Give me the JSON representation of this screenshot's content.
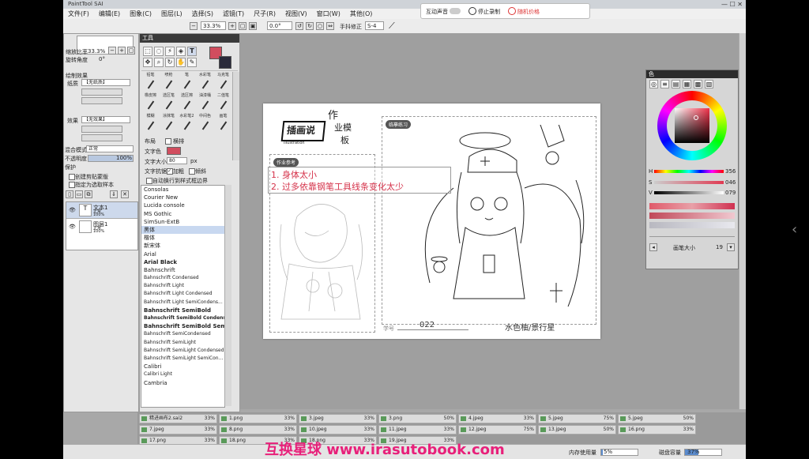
{
  "window": {
    "title": "PaintTool SAI"
  },
  "menu": [
    "文件(F)",
    "编辑(E)",
    "图象(C)",
    "图层(L)",
    "选择(S)",
    "滤镜(T)",
    "尺子(R)",
    "视图(V)",
    "窗口(W)",
    "其他(O)"
  ],
  "overlay": {
    "live_toggle_label": "互动声音",
    "stop_label": "停止录制",
    "restart_label": "随机价格"
  },
  "toolbar": {
    "zoom": "33.3%",
    "rotate": "0.0°",
    "stabilizer_label": "手抖修正",
    "stabilizer_value": "S-4"
  },
  "navigator": {
    "zoom_label": "缩放比率",
    "zoom_value": "33.3%",
    "angle_label": "旋转角度",
    "angle_value": "0°"
  },
  "layer_panel": {
    "effect_label": "绘制效果",
    "texture_label": "纸质",
    "texture_value": "【无纸质】",
    "effect2_label": "效果",
    "effect2_value": "【无效果】",
    "blend_label": "混合模式",
    "blend_value": "正常",
    "opacity_label": "不透明度",
    "opacity_value": "100%",
    "lock_label": "保护",
    "clip_group_label": "创建剪贴蒙版",
    "preset_label": "指定为选取样本",
    "layers": [
      {
        "name": "文本1",
        "mode": "正常",
        "opacity": "100%"
      },
      {
        "name": "图层1",
        "mode": "正常",
        "opacity": "100%"
      }
    ]
  },
  "tool_panel": {
    "title": "工具",
    "brushes": [
      "铅笔",
      "喷枪",
      "笔",
      "水彩笔",
      "马克笔",
      "橡皮擦",
      "选区笔",
      "选区擦",
      "油漆桶",
      "二值笔",
      "模糊",
      "涂抹笔",
      "水彩笔2",
      "中间色",
      "画笔"
    ],
    "layout_label": "布局",
    "layout_value": "横排",
    "color_label": "文字色",
    "size_label": "文字大小",
    "size_value": "80",
    "size_unit": "px",
    "antialias_label": "文字抗锯",
    "bold_label": "加粗",
    "italic_label": "倾斜",
    "wrap_label": "自动换行到样式框边界",
    "fonts": [
      "Consolas",
      "Courier New",
      "Lucida console",
      "MS Gothic",
      "SimSun-ExtB",
      "黑体",
      "楷体",
      "新宋体",
      "Arial",
      "Arial Black",
      "Bahnschrift",
      "Bahnschrift Condensed",
      "Bahnschrift Light",
      "Bahnschrift Light Condensed",
      "Bahnschrift Light SemiCondens...",
      "Bahnschrift SemiBold",
      "Bahnschrift SemiBold Condensed",
      "Bahnschrift SemiBold SemiCon...",
      "Bahnschrift SemiCondensed",
      "Bahnschrift SemiLight",
      "Bahnschrift SemiLight Condensed",
      "Bahnschrift SemiLight SemiCon...",
      "Calibri",
      "Calibri Light",
      "Cambria"
    ],
    "selected_font": "黑体"
  },
  "canvas": {
    "logo_main": "插画说",
    "logo_sub": "illustration",
    "logo_hw1": "作",
    "logo_hw2": "业模",
    "logo_hw3": "板",
    "left_tag": "作业参考",
    "right_tag": "临摹练习",
    "note1": "1. 身体太小",
    "note2": "2. 过多依靠钢笔工具线条变化太少",
    "number_label": "学号",
    "number_value": "022",
    "signature": "水色柚/景行星"
  },
  "color_panel": {
    "title": "色",
    "h_label": "H",
    "h_value": "356",
    "s_label": "S",
    "s_value": "046",
    "v_label": "V",
    "v_value": "079",
    "brush_size_label": "画笔大小",
    "brush_size_value": "19"
  },
  "doc_tabs": [
    {
      "name": "精进画布2.sai2",
      "pct": "33%"
    },
    {
      "name": "1.png",
      "pct": "33%"
    },
    {
      "name": "3.jpeg",
      "pct": "33%"
    },
    {
      "name": "3.png",
      "pct": "50%"
    },
    {
      "name": "4.jpeg",
      "pct": "33%"
    },
    {
      "name": "5.jpeg",
      "pct": "75%"
    },
    {
      "name": "5.jpeg",
      "pct": "50%"
    },
    {
      "name": "7.jpeg",
      "pct": "33%"
    },
    {
      "name": "8.png",
      "pct": "33%"
    },
    {
      "name": "10.jpeg",
      "pct": "33%"
    },
    {
      "name": "11.jpeg",
      "pct": "33%"
    },
    {
      "name": "12.jpeg",
      "pct": "75%"
    },
    {
      "name": "13.jpeg",
      "pct": "50%"
    },
    {
      "name": "16.png",
      "pct": "33%"
    },
    {
      "name": "17.png",
      "pct": "33%"
    },
    {
      "name": "18.png",
      "pct": "33%"
    },
    {
      "name": "18.png",
      "pct": "33%"
    },
    {
      "name": "19.jpeg",
      "pct": "33%"
    }
  ],
  "status": {
    "memory_label": "内存使用量",
    "memory_value": "5%",
    "disk_label": "磁盘容量",
    "disk_value": "37%"
  },
  "watermark": "互换星球 www.irasutobook.com"
}
